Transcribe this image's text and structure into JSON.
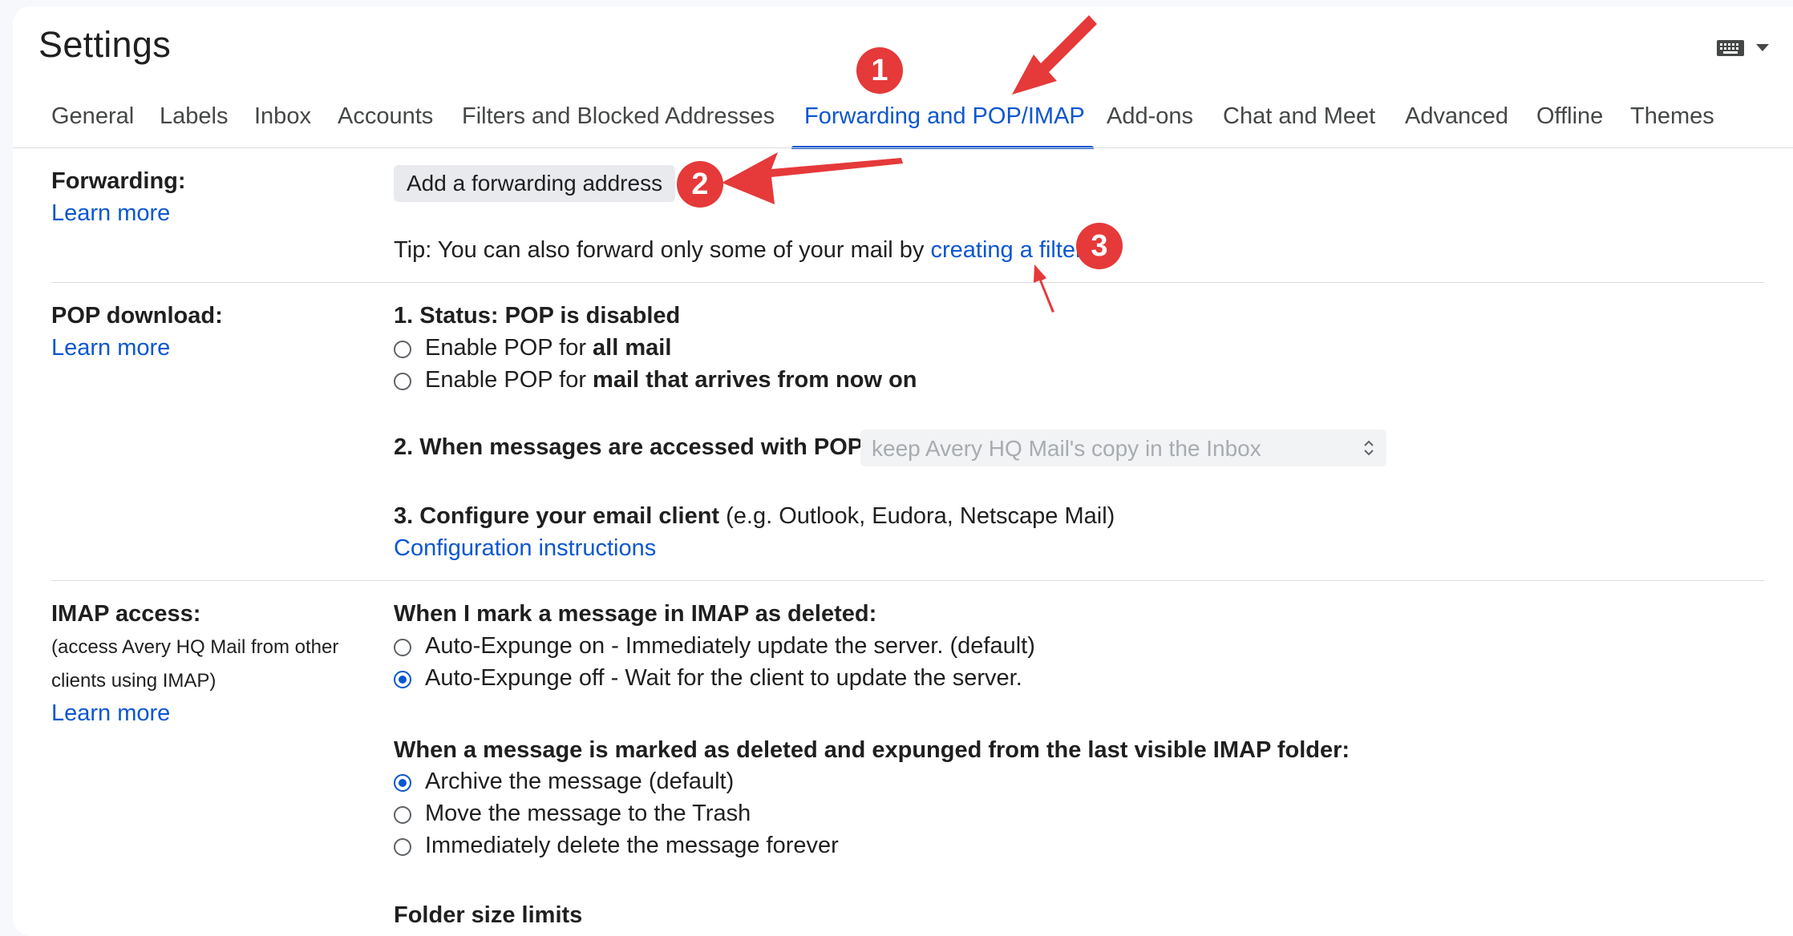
{
  "header": {
    "title": "Settings",
    "keyboard_icon": "keyboard-icon"
  },
  "tabs": [
    {
      "label": "General"
    },
    {
      "label": "Labels"
    },
    {
      "label": "Inbox"
    },
    {
      "label": "Accounts"
    },
    {
      "label": "Filters and Blocked Addresses"
    },
    {
      "label": "Forwarding and POP/IMAP",
      "active": true
    },
    {
      "label": "Add-ons"
    },
    {
      "label": "Chat and Meet"
    },
    {
      "label": "Advanced"
    },
    {
      "label": "Offline"
    },
    {
      "label": "Themes"
    }
  ],
  "forwarding": {
    "label": "Forwarding:",
    "learn_more": "Learn more",
    "add_button": "Add a forwarding address",
    "tip_prefix": "Tip: You can also forward only some of your mail by ",
    "tip_link": "creating a filter",
    "tip_suffix": "!"
  },
  "pop": {
    "label": "POP download:",
    "learn_more": "Learn more",
    "status": "1. Status: POP is disabled",
    "option1_prefix": "Enable POP for ",
    "option1_bold": "all mail",
    "option2_prefix": "Enable POP for ",
    "option2_bold": "mail that arrives from now on",
    "when_accessed": "2. When messages are accessed with POP",
    "select_value": "keep Avery HQ Mail's copy in the Inbox",
    "configure_bold": "3. Configure your email client",
    "configure_rest": " (e.g. Outlook, Eudora, Netscape Mail)",
    "config_link": "Configuration instructions"
  },
  "imap": {
    "label": "IMAP access:",
    "sub_line1": "(access Avery HQ Mail from other",
    "sub_line2": "clients using IMAP)",
    "learn_more": "Learn more",
    "deleted_heading": "When I mark a message in IMAP as deleted:",
    "expunge_on": "Auto-Expunge on - Immediately update the server. (default)",
    "expunge_off": "Auto-Expunge off - Wait for the client to update the server.",
    "expunged_heading": "When a message is marked as deleted and expunged from the last visible IMAP folder:",
    "archive": "Archive the message (default)",
    "trash": "Move the message to the Trash",
    "delete_forever": "Immediately delete the message forever",
    "folder_limits": "Folder size limits"
  },
  "annotations": {
    "badge1": "1",
    "badge2": "2",
    "badge3": "3",
    "color": "#e5393a"
  },
  "colors": {
    "accent": "#0b57d0",
    "annotation": "#e5393a"
  }
}
